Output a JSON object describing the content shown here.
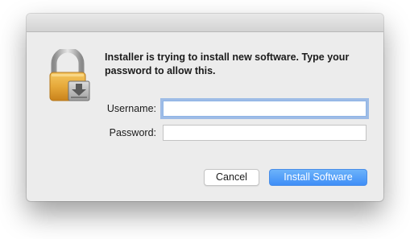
{
  "dialog": {
    "message": "Installer is trying to install new software. Type your password to allow this.",
    "icon": "lock-icon",
    "username": {
      "label": "Username:",
      "value": "",
      "focused": true
    },
    "password": {
      "label": "Password:",
      "value": ""
    },
    "buttons": {
      "cancel_label": "Cancel",
      "install_label": "Install Software"
    }
  },
  "colors": {
    "dialog_background": "#ececec",
    "accent": "#3f8ef7",
    "focus_ring": "#5f96e1",
    "lock_gold": "#e6a93a"
  }
}
